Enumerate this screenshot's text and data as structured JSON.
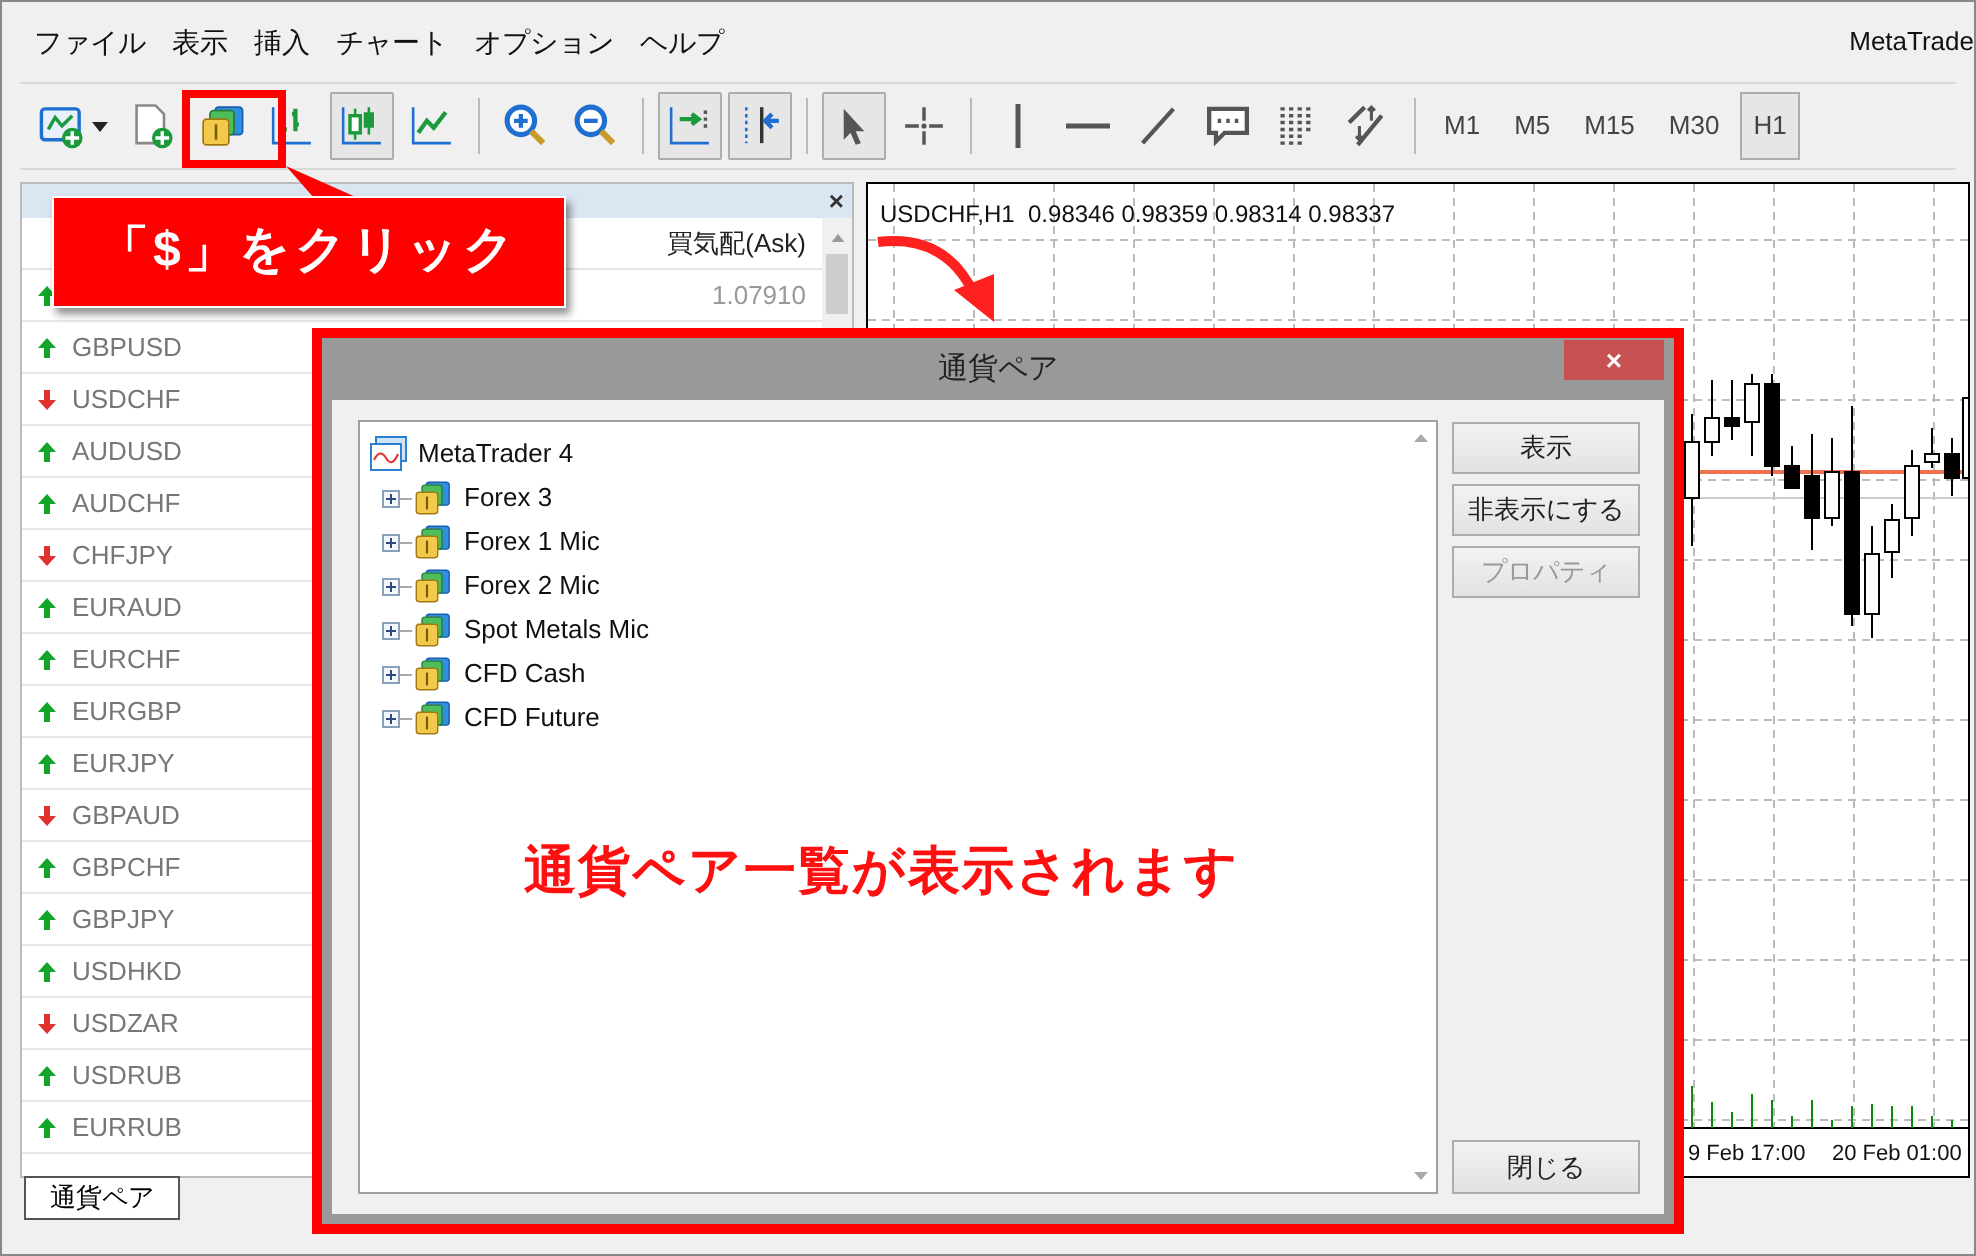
{
  "menu_bar": {
    "items": [
      "ファイル",
      "表示",
      "挿入",
      "チャート",
      "オプション",
      "ヘルプ"
    ],
    "app_title": "MetaTrade"
  },
  "toolbar": {
    "tools": [
      {
        "kind": "new-chart",
        "pressed": false
      },
      {
        "kind": "new-profile",
        "pressed": false
      },
      {
        "kind": "symbols",
        "pressed": false
      },
      {
        "kind": "bars",
        "pressed": false
      },
      {
        "kind": "candles",
        "pressed": true
      },
      {
        "kind": "line",
        "pressed": false
      },
      {
        "kind": "zoom-in",
        "pressed": false
      },
      {
        "kind": "zoom-out",
        "pressed": false
      },
      {
        "kind": "autoscroll",
        "pressed": true
      },
      {
        "kind": "shift",
        "pressed": true
      },
      {
        "kind": "cursor",
        "pressed": true
      },
      {
        "kind": "crosshair",
        "pressed": false
      },
      {
        "kind": "vline",
        "pressed": false
      },
      {
        "kind": "hline",
        "pressed": false
      },
      {
        "kind": "trendline",
        "pressed": false
      },
      {
        "kind": "text",
        "pressed": false
      },
      {
        "kind": "fibo",
        "pressed": false
      },
      {
        "kind": "elliott",
        "pressed": false
      }
    ],
    "timeframes": [
      {
        "label": "M1",
        "selected": false
      },
      {
        "label": "M5",
        "selected": false
      },
      {
        "label": "M15",
        "selected": false
      },
      {
        "label": "M30",
        "selected": false
      },
      {
        "label": "H1",
        "selected": true
      }
    ]
  },
  "market_watch": {
    "close_icon": "×",
    "columns": [
      "買気配(Ask)"
    ],
    "rows": [
      {
        "rising": true,
        "ask": "1.07910"
      },
      {
        "rising": true,
        "symbol": "GBPUSD"
      },
      {
        "rising": false,
        "symbol": "USDCHF"
      },
      {
        "rising": true,
        "symbol": "AUDUSD"
      },
      {
        "rising": true,
        "symbol": "AUDCHF"
      },
      {
        "rising": false,
        "symbol": "CHFJPY"
      },
      {
        "rising": true,
        "symbol": "EURAUD"
      },
      {
        "rising": true,
        "symbol": "EURCHF"
      },
      {
        "rising": true,
        "symbol": "EURGBP"
      },
      {
        "rising": true,
        "symbol": "EURJPY"
      },
      {
        "rising": false,
        "symbol": "GBPAUD"
      },
      {
        "rising": true,
        "symbol": "GBPCHF"
      },
      {
        "rising": true,
        "symbol": "GBPJPY"
      },
      {
        "rising": true,
        "symbol": "USDHKD"
      },
      {
        "rising": false,
        "symbol": "USDZAR"
      },
      {
        "rising": true,
        "symbol": "USDRUB"
      },
      {
        "rising": true,
        "symbol": "EURRUB"
      }
    ],
    "tab": "通貨ペア"
  },
  "chart": {
    "title": "USDCHF,H1  0.98346 0.98359 0.98314 0.98337",
    "time_labels": [
      "9 Feb 17:00",
      "20 Feb 01:00"
    ]
  },
  "callout": "「$」をクリック",
  "dialog": {
    "title": "通貨ペア",
    "close_icon": "×",
    "tree": {
      "label": "MetaTrader 4",
      "children": [
        {
          "label": "Forex 3",
          "expanded": false
        },
        {
          "label": "Forex 1 Mic",
          "expanded": false
        },
        {
          "label": "Forex 2 Mic",
          "expanded": false
        },
        {
          "label": "Spot Metals Mic",
          "expanded": false
        },
        {
          "label": "CFD Cash",
          "expanded": false
        },
        {
          "label": "CFD Future",
          "expanded": false
        }
      ]
    },
    "annotation": "通貨ペア一覧が表示されます",
    "buttons": [
      {
        "label": "表示",
        "disabled": false
      },
      {
        "label": "非表示にする",
        "disabled": false
      },
      {
        "label": "プロパティ",
        "disabled": true
      }
    ],
    "close_button": "閉じる"
  }
}
